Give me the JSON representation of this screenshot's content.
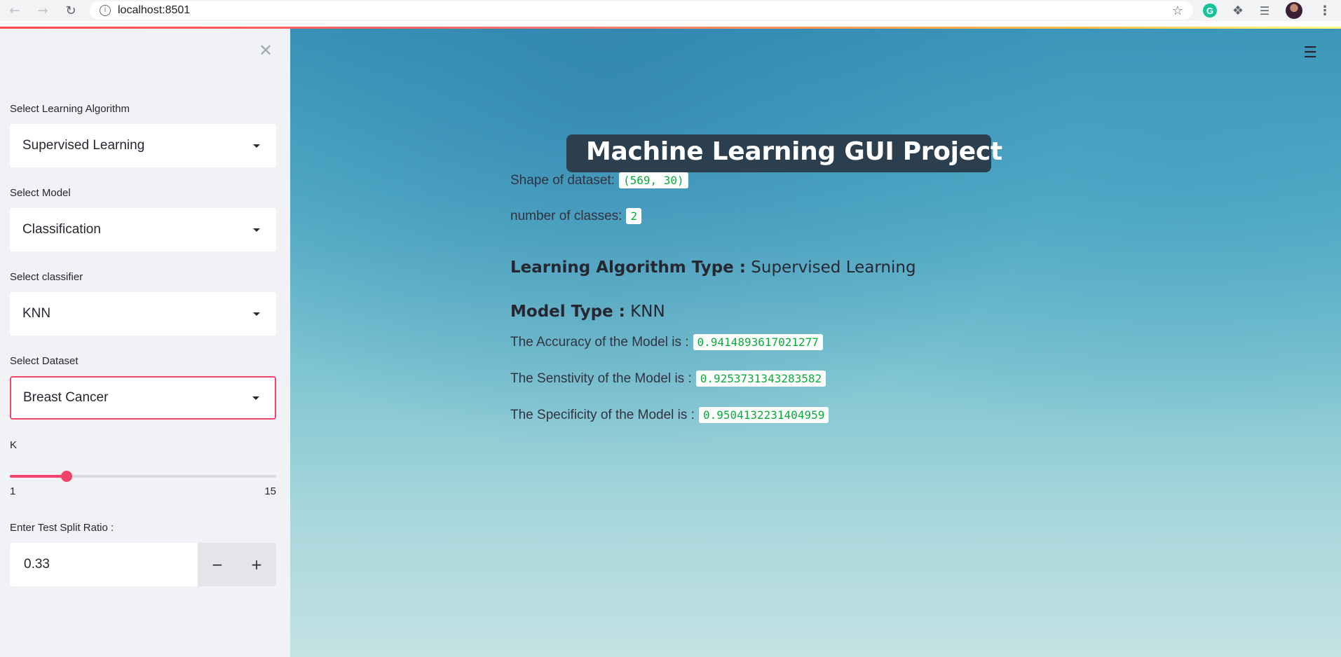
{
  "browser": {
    "url": "localhost:8501",
    "back_icon": "arrow-left-icon",
    "forward_icon": "arrow-right-icon",
    "reload_icon": "reload-icon",
    "info_icon": "info-icon",
    "bookmark_icon": "star-icon",
    "extensions": [
      "grammarly-icon",
      "puzzle-icon",
      "media-control-icon",
      "profile-avatar",
      "more-vert-icon"
    ]
  },
  "sidebar": {
    "close_icon": "close-icon",
    "algorithm": {
      "label": "Select Learning Algorithm",
      "value": "Supervised Learning"
    },
    "model": {
      "label": "Select Model",
      "value": "Classification"
    },
    "classifier": {
      "label": "Select classifier",
      "value": "KNN"
    },
    "dataset": {
      "label": "Select Dataset",
      "value": "Breast Cancer"
    },
    "k_slider": {
      "label": "K",
      "min": "1",
      "max": "15",
      "value": 4
    },
    "test_split": {
      "label": "Enter Test Split Ratio :",
      "value": "0.33",
      "minus": "−",
      "plus": "+"
    }
  },
  "main": {
    "menu_icon": "hamburger-menu-icon",
    "title": "Machine Learning GUI Project",
    "shape_label": "Shape of dataset:",
    "shape_value": "(569, 30)",
    "classes_label": "number of classes:",
    "classes_value": "2",
    "algo_heading_label": "Learning Algorithm Type :",
    "algo_heading_value": " Supervised Learning",
    "model_heading_label": "Model Type :",
    "model_heading_value": " KNN",
    "accuracy_label": "The Accuracy of the Model is :",
    "accuracy_value": "0.9414893617021277",
    "sensitivity_label": "The Senstivity of the Model is :",
    "sensitivity_value": "0.9253731343283582",
    "specificity_label": "The Specificity of the Model is :",
    "specificity_value": "0.9504132231404959"
  },
  "colors": {
    "primary": "#f0436a",
    "sidebar_bg": "#f0f2f6",
    "title_box": "#2b3f4f",
    "code_text": "#09ab3b"
  }
}
